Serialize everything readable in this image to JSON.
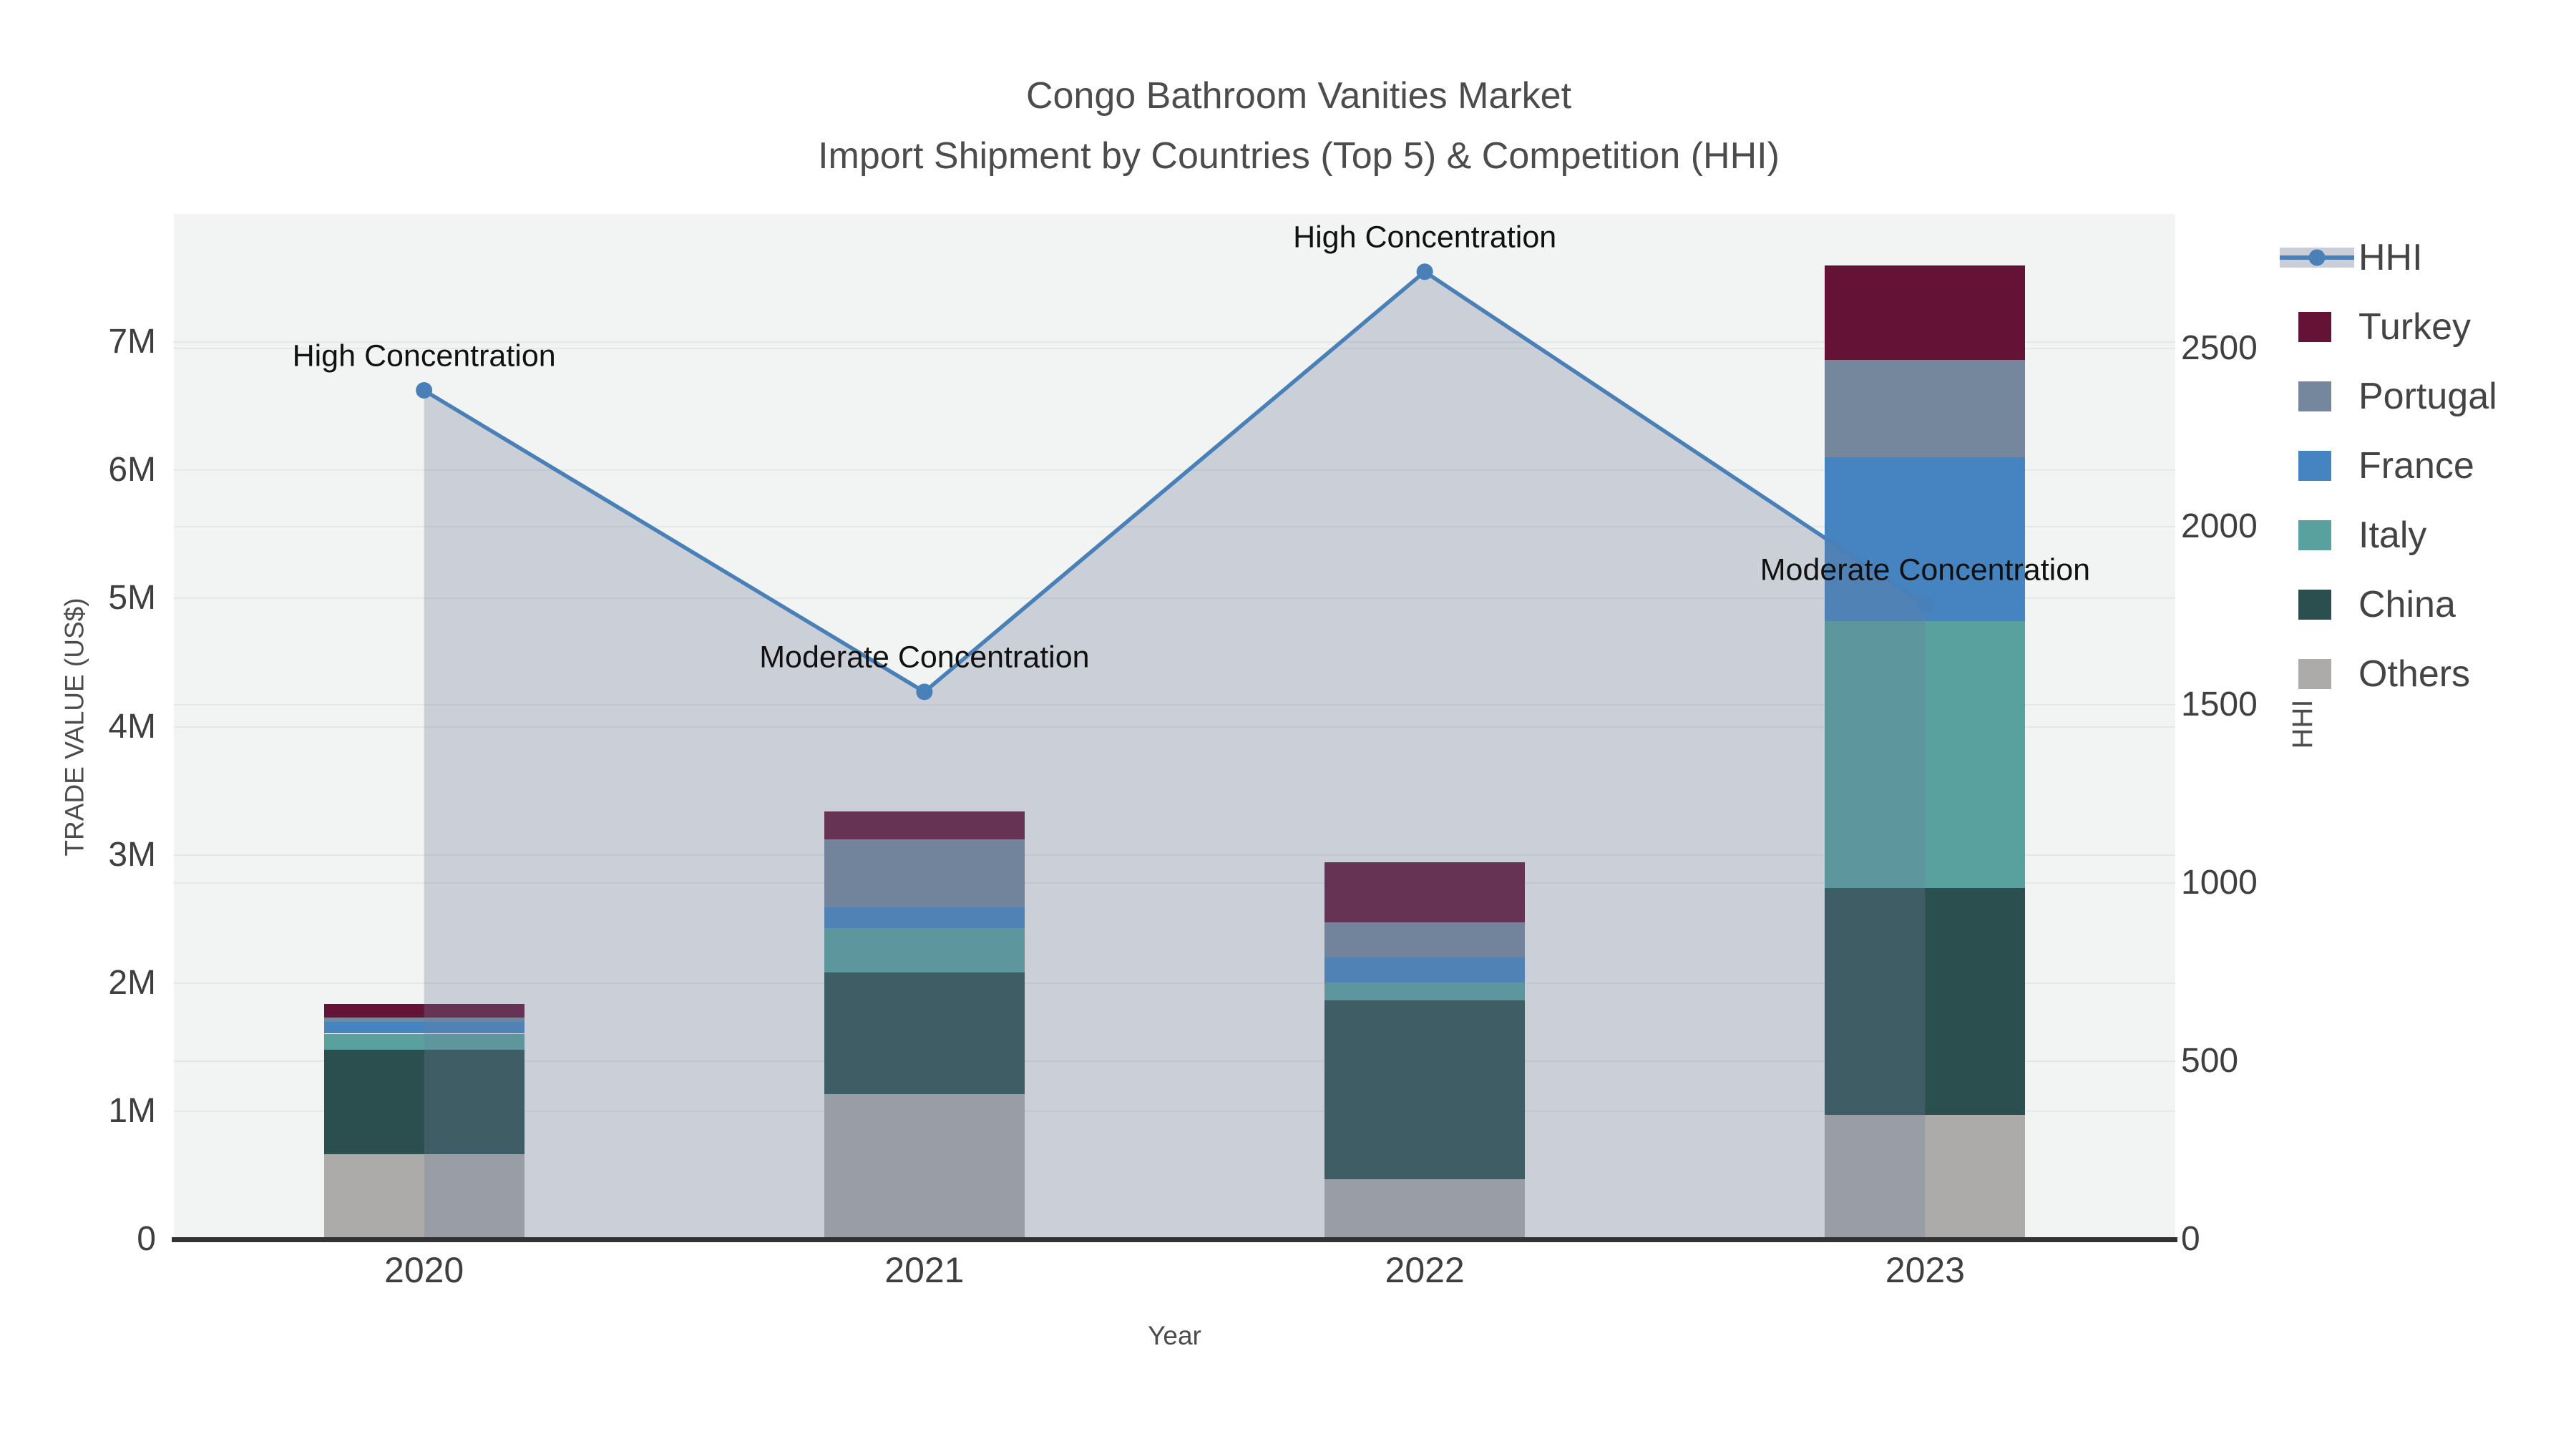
{
  "title": {
    "line1": "Congo Bathroom Vanities Market",
    "line2": "Import Shipment by Countries (Top 5) & Competition (HHI)"
  },
  "axes": {
    "x": {
      "title": "Year",
      "tick_labels": [
        "2020",
        "2021",
        "2022",
        "2023"
      ]
    },
    "y_left": {
      "title": "TRADE VALUE (US$)",
      "tick_labels": [
        "0",
        "1M",
        "2M",
        "3M",
        "4M",
        "5M",
        "6M",
        "7M"
      ],
      "tick_values_musd": [
        0,
        1,
        2,
        3,
        4,
        5,
        6,
        7
      ],
      "range_musd": [
        0,
        8
      ]
    },
    "y_right": {
      "title": "HHI",
      "tick_labels": [
        "0",
        "500",
        "1000",
        "1500",
        "2000",
        "2500"
      ],
      "tick_values": [
        0,
        500,
        1000,
        1500,
        2000,
        2500
      ],
      "range": [
        0,
        2877
      ]
    }
  },
  "legend": {
    "items": [
      {
        "label": "HHI",
        "type": "line",
        "color": "#4a80b8"
      },
      {
        "label": "Turkey",
        "type": "swatch",
        "color": "#641337"
      },
      {
        "label": "Portugal",
        "type": "swatch",
        "color": "#75879c"
      },
      {
        "label": "France",
        "type": "swatch",
        "color": "#4584c1"
      },
      {
        "label": "Italy",
        "type": "swatch",
        "color": "#58a19e"
      },
      {
        "label": "China",
        "type": "swatch",
        "color": "#2b4f4e"
      },
      {
        "label": "Others",
        "type": "swatch",
        "color": "#acabaa"
      }
    ]
  },
  "chart_data": {
    "type": [
      "bar",
      "line"
    ],
    "bar_mode": "stacked",
    "categories": [
      "2020",
      "2021",
      "2022",
      "2023"
    ],
    "bar_value_unit": "US$",
    "bar_series_bottom_to_top": [
      {
        "name": "Others",
        "color": "#acabaa",
        "values": [
          665000,
          1135000,
          470000,
          970000
        ]
      },
      {
        "name": "China",
        "color": "#2b4f4e",
        "values": [
          815000,
          950000,
          1395000,
          1770000
        ]
      },
      {
        "name": "Italy",
        "color": "#58a19e",
        "values": [
          125000,
          345000,
          140000,
          2085000
        ]
      },
      {
        "name": "France",
        "color": "#4584c1",
        "values": [
          90000,
          160000,
          195000,
          1275000
        ]
      },
      {
        "name": "Portugal",
        "color": "#75879c",
        "values": [
          35000,
          530000,
          275000,
          760000
        ]
      },
      {
        "name": "Turkey",
        "color": "#641337",
        "values": [
          105000,
          220000,
          465000,
          740000
        ]
      }
    ],
    "bar_totals_usd": [
      1835000,
      3340000,
      2940000,
      7600000
    ],
    "line_series": {
      "name": "HHI",
      "axis": "right",
      "color": "#4a80b8",
      "fill": "tozeroy",
      "fill_color": "rgba(110,126,154,0.30)",
      "values": [
        2382,
        1536,
        2715,
        1781
      ]
    },
    "annotations": [
      {
        "category": "2020",
        "text": "High Concentration"
      },
      {
        "category": "2021",
        "text": "Moderate Concentration"
      },
      {
        "category": "2022",
        "text": "High Concentration"
      },
      {
        "category": "2023",
        "text": "Moderate Concentration"
      }
    ],
    "xlabel": "Year",
    "ylabel_left": "TRADE VALUE (US$)",
    "ylabel_right": "HHI",
    "grid": true,
    "legend_position": "right",
    "plot_bg_color": "#f2f3f3"
  }
}
